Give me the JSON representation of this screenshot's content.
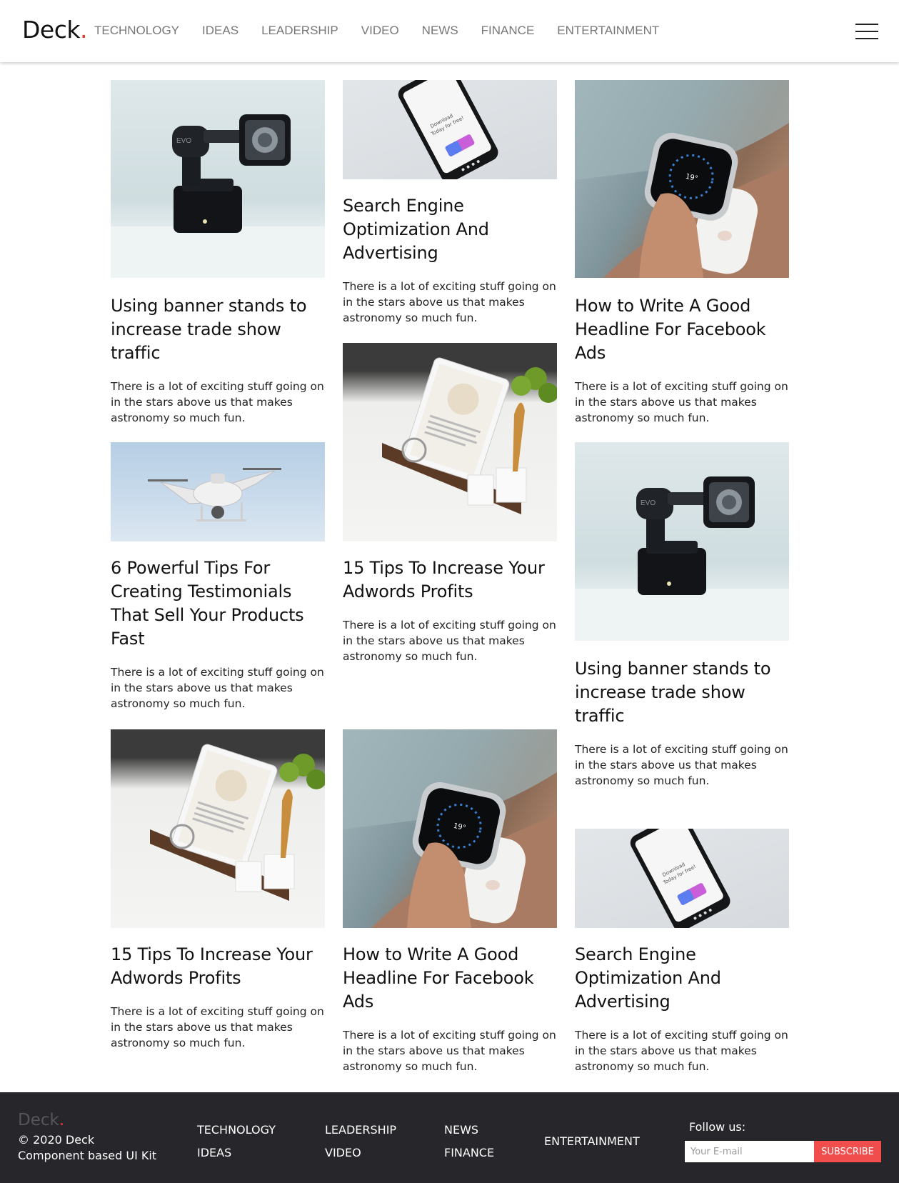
{
  "header": {
    "logo": "Deck",
    "logo_dot": ".",
    "nav": [
      "TECHNOLOGY",
      "IDEAS",
      "LEADERSHIP",
      "VIDEO",
      "NEWS",
      "FINANCE",
      "ENTERTAINMENT"
    ]
  },
  "cards": [
    {
      "image": "gimbal-camera-image",
      "title": "Using banner stands to increase trade show traffic",
      "excerpt": "There is a lot of exciting stuff going on in the stars above us that makes astronomy so much fun."
    },
    {
      "image": "smartphone-image",
      "title": "Search Engine Optimization And Advertising",
      "excerpt": "There is a lot of exciting stuff going on in the stars above us that makes astronomy so much fun."
    },
    {
      "image": "smartwatch-image",
      "title": "How to Write A Good Headline For Facebook Ads",
      "excerpt": "There is a lot of exciting stuff going on in the stars above us that makes astronomy so much fun."
    },
    {
      "image": "drone-image",
      "title": "6 Powerful Tips For Creating Testimonials That Sell Your Products Fast",
      "excerpt": "There is a lot of exciting stuff going on in the stars above us that makes astronomy so much fun."
    },
    {
      "image": "tablet-kitchen-image",
      "title": "15 Tips To Increase Your Adwords Profits",
      "excerpt": "There is a lot of exciting stuff going on in the stars above us that makes astronomy so much fun."
    },
    {
      "image": "gimbal-camera-image",
      "title": "Using banner stands to increase trade show traffic",
      "excerpt": "There is a lot of exciting stuff going on in the stars above us that makes astronomy so much fun."
    },
    {
      "image": "tablet-kitchen-image",
      "title": "15 Tips To Increase Your Adwords Profits",
      "excerpt": "There is a lot of exciting stuff going on in the stars above us that makes astronomy so much fun."
    },
    {
      "image": "smartwatch-image",
      "title": "How to Write A Good Headline For Facebook Ads",
      "excerpt": "There is a lot of exciting stuff going on in the stars above us that makes astronomy so much fun."
    },
    {
      "image": "smartphone-image",
      "title": "Search Engine Optimization And Advertising",
      "excerpt": "There is a lot of exciting stuff going on in the stars above us that makes astronomy so much fun."
    }
  ],
  "footer": {
    "logo": "Deck",
    "logo_dot": ".",
    "copyright": "© 2020 Deck",
    "tagline": "Component based UI Kit",
    "links": [
      "TECHNOLOGY",
      "IDEAS",
      "LEADERSHIP",
      "VIDEO",
      "NEWS",
      "FINANCE",
      "ENTERTAINMENT"
    ],
    "follow_label": "Follow us:",
    "email_placeholder": "Your E-mail",
    "subscribe_label": "SUBSCRIBE"
  },
  "colors": {
    "accent": "#e8372e",
    "subscribe_button": "#f24d4d",
    "footer_bg": "#26262b",
    "nav_text": "#777777"
  }
}
